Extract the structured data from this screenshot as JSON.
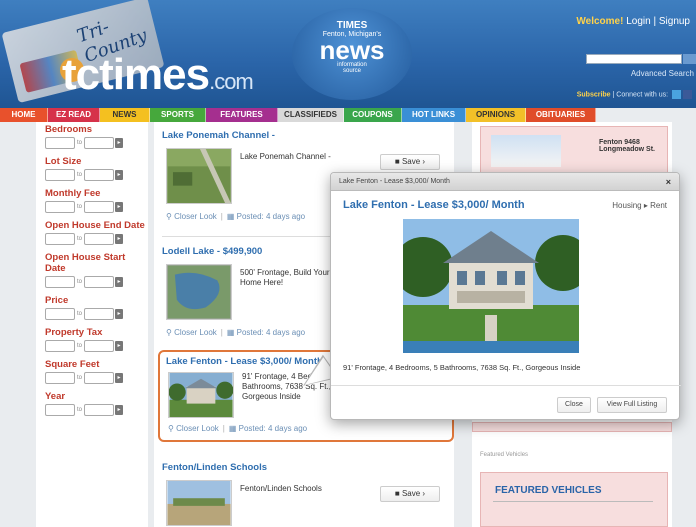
{
  "header": {
    "paper_text": "Tri-County",
    "logo_main": "tctimes",
    "logo_com": ".com",
    "badge_times": "TIMES",
    "badge_sub": "Fenton, Michigan's",
    "badge_news": "news",
    "badge_info1": "information",
    "badge_info2": "source",
    "welcome": "Welcome!",
    "login": "Login",
    "signup": "Signup",
    "advanced_search": "Advanced Search",
    "subscribe": "Subscribe",
    "connect": "Connect with us:"
  },
  "nav": {
    "items": [
      {
        "label": "HOME",
        "color": "#e8512c"
      },
      {
        "label": "EZ READ",
        "color": "#d6324a"
      },
      {
        "label": "NEWS",
        "color": "#f4c020",
        "text": "#333"
      },
      {
        "label": "SPORTS",
        "color": "#46a83c"
      },
      {
        "label": "FEATURES",
        "color": "#a52f8f"
      },
      {
        "label": "CLASSIFIEDS",
        "color": "#d9d9d9",
        "text": "#333"
      },
      {
        "label": "COUPONS",
        "color": "#3aa64c"
      },
      {
        "label": "HOT LINKS",
        "color": "#3a8fd6"
      },
      {
        "label": "OPINIONS",
        "color": "#f2c028",
        "text": "#333"
      },
      {
        "label": "OBITUARIES",
        "color": "#e04d2a"
      }
    ]
  },
  "filters": {
    "to": "to",
    "go": "▸",
    "labels": [
      "Bedrooms",
      "Lot Size",
      "Monthly Fee",
      "Open House End Date",
      "Open House Start Date",
      "Price",
      "Property Tax",
      "Square Feet",
      "Year"
    ]
  },
  "listings": [
    {
      "title": "Lake Ponemah Channel -",
      "desc": "Lake Ponemah Channel -",
      "closer": "Closer Look",
      "posted": "Posted: 4 days ago",
      "save": "Save"
    },
    {
      "title": "Lodell Lake - $499,900",
      "desc": "500' Frontage, Build Your Dream Home Here!",
      "closer": "Closer Look",
      "posted": "Posted: 4 days ago"
    },
    {
      "title": "Lake Fenton - Lease $3,000/ Month",
      "desc": "91' Frontage, 4 Bedrooms, 5 Bathrooms, 7638 Sq. Ft., Gorgeous Inside",
      "closer": "Closer Look",
      "posted": "Posted: 4 days ago"
    },
    {
      "title": "Fenton/Linden Schools",
      "desc": "Fenton/Linden Schools",
      "save": "Save"
    }
  ],
  "right": {
    "ad_text": "Fenton 9468 Longmeadow St.",
    "featured_label": "Featured Vehicles",
    "featured_title": "FEATURED VEHICLES"
  },
  "modal": {
    "bar_title": "Lake Fenton - Lease $3,000/ Month",
    "close": "×",
    "title": "Lake Fenton - Lease $3,000/ Month",
    "crumb": "Housing ▸ Rent",
    "desc": "91' Frontage, 4 Bedrooms, 5 Bathrooms, 7638 Sq. Ft., Gorgeous Inside",
    "close_btn": "Close",
    "full_btn": "View Full Listing"
  }
}
